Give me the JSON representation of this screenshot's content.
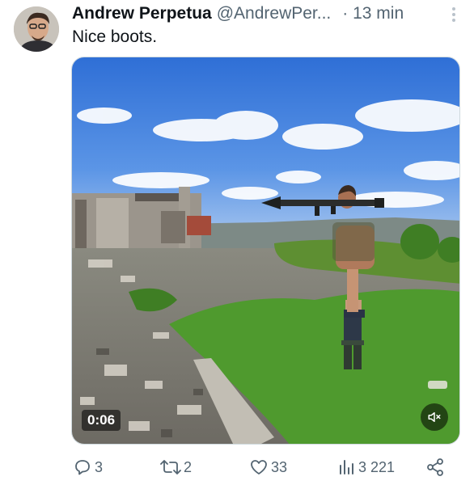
{
  "tweet": {
    "author_name": "Andrew Perpetua",
    "handle": "@AndrewPer...",
    "time": "· 13 min",
    "text": "Nice boots."
  },
  "media": {
    "duration": "0:06"
  },
  "actions": {
    "replies": "3",
    "reposts": "2",
    "likes": "33",
    "views": "3 221"
  },
  "colors": {
    "text": "#0f1419",
    "secondary": "#536471",
    "border": "#cfd9de"
  }
}
